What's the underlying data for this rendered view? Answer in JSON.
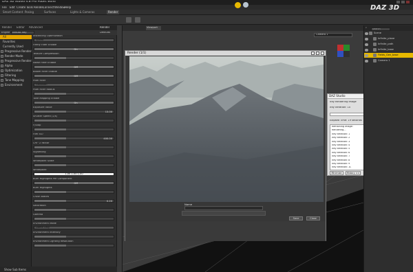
{
  "window": {
    "title": "DAZ 3D Studio 4.8 Pro Public Build",
    "logo": "DAZ 3D"
  },
  "menu": [
    "File",
    "Edit",
    "Create",
    "Tools",
    "Render",
    "Connect",
    "Window",
    "Help"
  ],
  "tabs": [
    "Smart Content",
    "Posing",
    "Surfaces",
    "Lights & Cameras",
    "Render"
  ],
  "left_panel": {
    "tabs": [
      "Render",
      "Editor",
      "Advanced"
    ],
    "header": {
      "engine_label": "Engine",
      "engine_value": "NVIDIA Iray",
      "preset": "Defaults",
      "render_button": "Render"
    },
    "categories": [
      {
        "label": "All",
        "selected": true
      },
      {
        "label": "Favorites"
      },
      {
        "label": "Currently Used"
      },
      {
        "label": "Progressive Rendering",
        "checkbox": true
      },
      {
        "label": "Render Mode",
        "checkbox": true
      },
      {
        "label": "Progressive Rendering",
        "checkbox": true
      },
      {
        "label": "Alpha",
        "checkbox": true
      },
      {
        "label": "Optimization",
        "checkbox": true
      },
      {
        "label": "Filtering",
        "checkbox": true
      },
      {
        "label": "Tone Mapping",
        "checkbox": true
      },
      {
        "label": "Environment",
        "checkbox": true
      }
    ],
    "properties": [
      {
        "label": "Instancing Optimization",
        "kind": "field",
        "value": "Speed"
      },
      {
        "label": "Firefly Filter Enable",
        "kind": "toggle",
        "value": "On"
      },
      {
        "label": "Texture Compression",
        "kind": "slider",
        "value": ""
      },
      {
        "label": "Noise Filter Enable",
        "kind": "toggle",
        "value": "Off"
      },
      {
        "label": "Bloom Filter Enable",
        "kind": "toggle",
        "value": "Off"
      },
      {
        "label": "Pixel Filter",
        "kind": "field",
        "value": "Gaussian"
      },
      {
        "label": "Pixel Filter Radius",
        "kind": "slider",
        "value": ""
      },
      {
        "label": "Tone Mapping Enable",
        "kind": "toggle",
        "value": "On"
      },
      {
        "label": "Exposure Value",
        "kind": "slider",
        "value": "13.00"
      },
      {
        "label": "Shutter Speed (1/s)",
        "kind": "slider",
        "value": ""
      },
      {
        "label": "F/Stop",
        "kind": "slider",
        "value": ""
      },
      {
        "label": "Film ISO",
        "kind": "slider",
        "value": "400.00"
      },
      {
        "label": "Cm^2 Factor",
        "kind": "slider",
        "value": ""
      },
      {
        "label": "Vignetting",
        "kind": "slider",
        "value": ""
      },
      {
        "label": "Whitepoint Scale",
        "kind": "slider",
        "value": ""
      },
      {
        "label": "Whitepoint",
        "kind": "white",
        "value": "1.00   1.00   1.00"
      },
      {
        "label": "Burn Highlights Per Component",
        "kind": "toggle",
        "value": "Off"
      },
      {
        "label": "Burn Highlights",
        "kind": "slider",
        "value": ""
      },
      {
        "label": "Crush Blacks",
        "kind": "slider",
        "value": "0.20"
      },
      {
        "label": "Saturation",
        "kind": "slider",
        "value": ""
      },
      {
        "label": "Gamma",
        "kind": "slider",
        "value": ""
      },
      {
        "label": "Environment Mode",
        "kind": "field",
        "value": "Dome Only"
      },
      {
        "label": "Environment Intensity",
        "kind": "slider",
        "value": ""
      },
      {
        "label": "Environment Lighting Resolution",
        "kind": "slider",
        "value": ""
      }
    ],
    "footer": "Show Sub Items"
  },
  "viewport": {
    "tab": "Viewport",
    "camera": "Camera 1"
  },
  "render_window": {
    "title": "Render (1/1)",
    "name_label": "Name",
    "save": "Save",
    "close": "Close"
  },
  "progress": {
    "title": "DAZ Studio",
    "line1": "Iray Rendering Image",
    "line2": "Iray Iteration: 10",
    "percent": "8%",
    "elapsed": "Elapsed Time: 19 seconds",
    "log": [
      "Remaining Image:",
      "Rendering...",
      "Iray Iteration: 1",
      "Iray Iteration: 2",
      "Iray Iteration: 3",
      "Iray Iteration: 4",
      "Iray Iteration: 5",
      "Iray Iteration: 6",
      "Iray Iteration: 7",
      "Iray Iteration: 8",
      "Iray Iteration: 9",
      "Iray Iteration: 10"
    ],
    "minimize": "Minimize",
    "history": "History >>",
    "cancel": "Cancel"
  },
  "scene": {
    "search": "Search",
    "nodes": [
      {
        "label": "Scene",
        "selected": false
      },
      {
        "label": "Infinite_plane",
        "selected": false
      },
      {
        "label": "Infinite_path",
        "selected": false
      },
      {
        "label": "Infinite_base",
        "selected": false
      },
      {
        "label": "Fields_Gen_base",
        "selected": true
      },
      {
        "label": "Camera 1",
        "selected": false
      }
    ]
  },
  "colors": {
    "accent": "#e6b800",
    "selection": "#e6a800"
  }
}
